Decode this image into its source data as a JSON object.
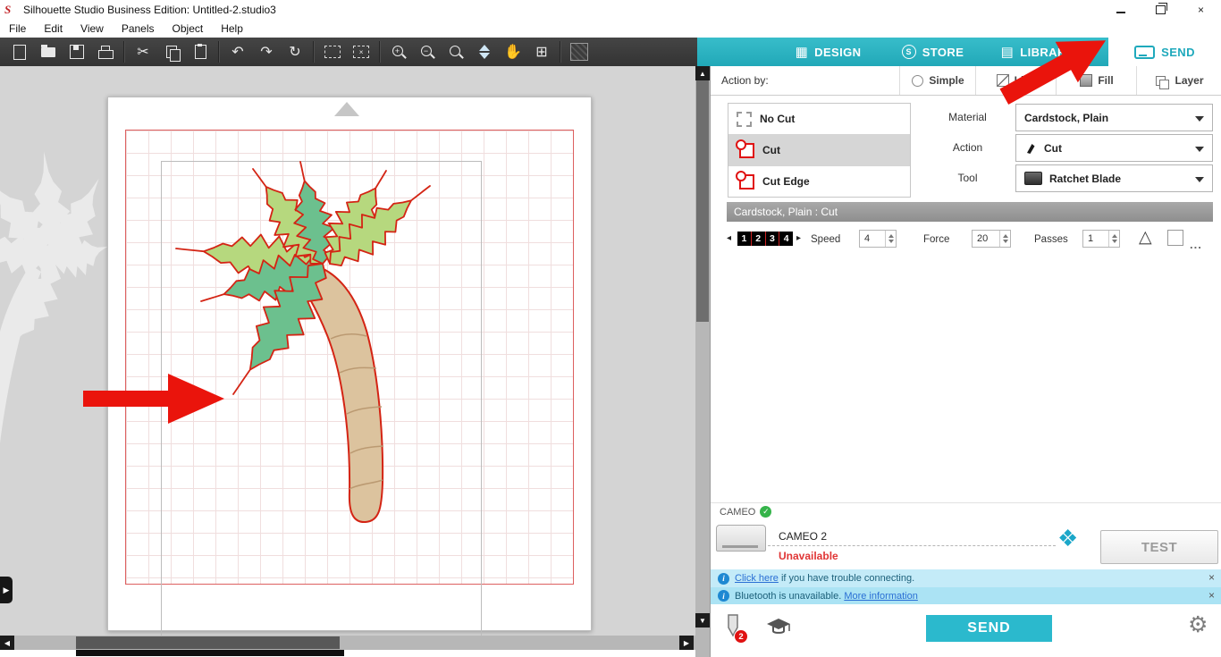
{
  "window": {
    "title": "Silhouette Studio Business Edition: Untitled-2.studio3",
    "app_initial": "S"
  },
  "menu": {
    "items": [
      "File",
      "Edit",
      "View",
      "Panels",
      "Object",
      "Help"
    ]
  },
  "tabs": {
    "design": "DESIGN",
    "store": "STORE",
    "library": "LIBRARY",
    "send": "SEND"
  },
  "panel": {
    "action_by": "Action by:",
    "modes": {
      "simple": "Simple",
      "line": "Line",
      "fill": "Fill",
      "layer": "Layer"
    },
    "styles": {
      "no_cut": "No Cut",
      "cut": "Cut",
      "cut_edge": "Cut Edge"
    },
    "material": {
      "label": "Material",
      "value": "Cardstock, Plain"
    },
    "action": {
      "label": "Action",
      "value": "Cut"
    },
    "tool": {
      "label": "Tool",
      "value": "Ratchet Blade"
    },
    "settings_header": "Cardstock, Plain : Cut",
    "blade": {
      "n1": "1",
      "n2": "2",
      "n3": "3",
      "n4": "4"
    },
    "speed": {
      "label": "Speed",
      "value": "4"
    },
    "force": {
      "label": "Force",
      "value": "20"
    },
    "passes": {
      "label": "Passes",
      "value": "1"
    },
    "more": "...",
    "device": {
      "section": "CAMEO",
      "name": "CAMEO 2",
      "status": "Unavailable",
      "test": "TEST"
    },
    "notices": {
      "n1_link": "Click here",
      "n1_text": " if you have trouble connecting.",
      "n2_text": "Bluetooth is unavailable. ",
      "n2_link": "More information"
    },
    "send": "SEND",
    "badge": "2"
  },
  "icons": {
    "scissors": "✂",
    "undo": "↶",
    "redo": "↷",
    "refresh": "↻",
    "pan": "✋",
    "fit_page": "⊞",
    "design": "▦",
    "library": "▤",
    "store": "S",
    "gear": "⚙",
    "nav": "❖",
    "check": "✓",
    "close": "×",
    "info": "i",
    "triangle": "△",
    "plus": "+",
    "minus": "−",
    "min": "–",
    "up": "▲",
    "down": "▼",
    "left": "◀",
    "right": "▶",
    "small_left": "◂",
    "small_right": "▸"
  },
  "colors": {
    "accent": "#2bb5c9",
    "red": "#ea140c",
    "leaf_light": "#b6d87e",
    "leaf_dark": "#6cc08e",
    "trunk": "#dcc39e",
    "outline": "#d42414"
  }
}
